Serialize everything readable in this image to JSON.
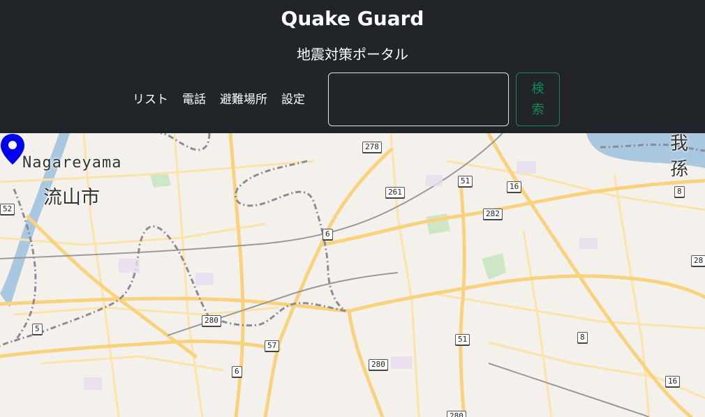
{
  "header": {
    "brand": "Quake Guard",
    "subtitle": "地震対策ポータル",
    "nav": [
      {
        "label": "リスト"
      },
      {
        "label": "電話"
      },
      {
        "label": "避難場所"
      },
      {
        "label": "設定"
      }
    ],
    "search": {
      "value": "",
      "button_label": "検索"
    }
  },
  "map": {
    "labels": {
      "city_en": "Nagareyama",
      "city_ja": "流山市",
      "city_partial": "我孫"
    },
    "route_shields": [
      "278",
      "261",
      "51",
      "16",
      "282",
      "6",
      "8",
      "52",
      "28",
      "280",
      "5",
      "57",
      "6",
      "51",
      "280",
      "8",
      "16",
      "280"
    ],
    "marker_color": "#0000ee",
    "road_color": "#f9d27e",
    "water_color": "#a9c8e0"
  }
}
